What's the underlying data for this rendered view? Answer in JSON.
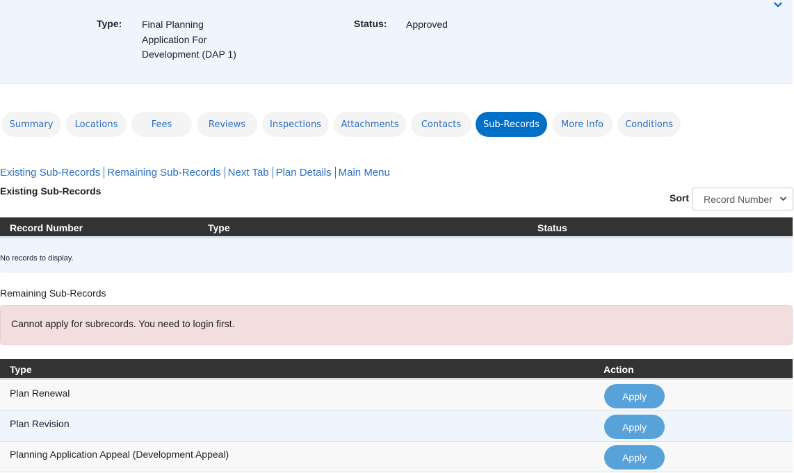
{
  "record_info": {
    "type_label": "Type:",
    "type_value": "Final Planning Application For Development (DAP 1)",
    "status_label": "Status:",
    "status_value": "Approved",
    "collapse_icon": "chevron-down-icon"
  },
  "tabs": [
    {
      "label": "Summary",
      "active": false
    },
    {
      "label": "Locations",
      "active": false
    },
    {
      "label": "Fees",
      "active": false
    },
    {
      "label": "Reviews",
      "active": false
    },
    {
      "label": "Inspections",
      "active": false
    },
    {
      "label": "Attachments",
      "active": false
    },
    {
      "label": "Contacts",
      "active": false
    },
    {
      "label": "Sub-Records",
      "active": true
    },
    {
      "label": "More Info",
      "active": false
    },
    {
      "label": "Conditions",
      "active": false
    }
  ],
  "section_links": [
    "Existing Sub-Records",
    "Remaining Sub-Records",
    "Next Tab",
    "Plan Details",
    "Main Menu"
  ],
  "existing": {
    "heading": "Existing Sub-Records",
    "sort_label": "Sort",
    "sort_selected": "Record Number",
    "columns": [
      "Record Number",
      "Type",
      "Status"
    ],
    "empty_message": "No records to display."
  },
  "remaining": {
    "heading": "Remaining Sub-Records",
    "alert": "Cannot apply for subrecords. You need to login first.",
    "columns": [
      "Type",
      "Action"
    ],
    "rows": [
      {
        "type": "Plan Renewal",
        "action": "Apply"
      },
      {
        "type": "Plan Revision",
        "action": "Apply"
      },
      {
        "type": "Planning Application Appeal (Development Appeal)",
        "action": "Apply"
      }
    ]
  },
  "colors": {
    "accent": "#0070c9",
    "link": "#2a6fc0",
    "table_header": "#333333",
    "panel_bg": "#eef5fd",
    "alert_bg": "#f2dede",
    "apply_button": "#57a3d9"
  }
}
